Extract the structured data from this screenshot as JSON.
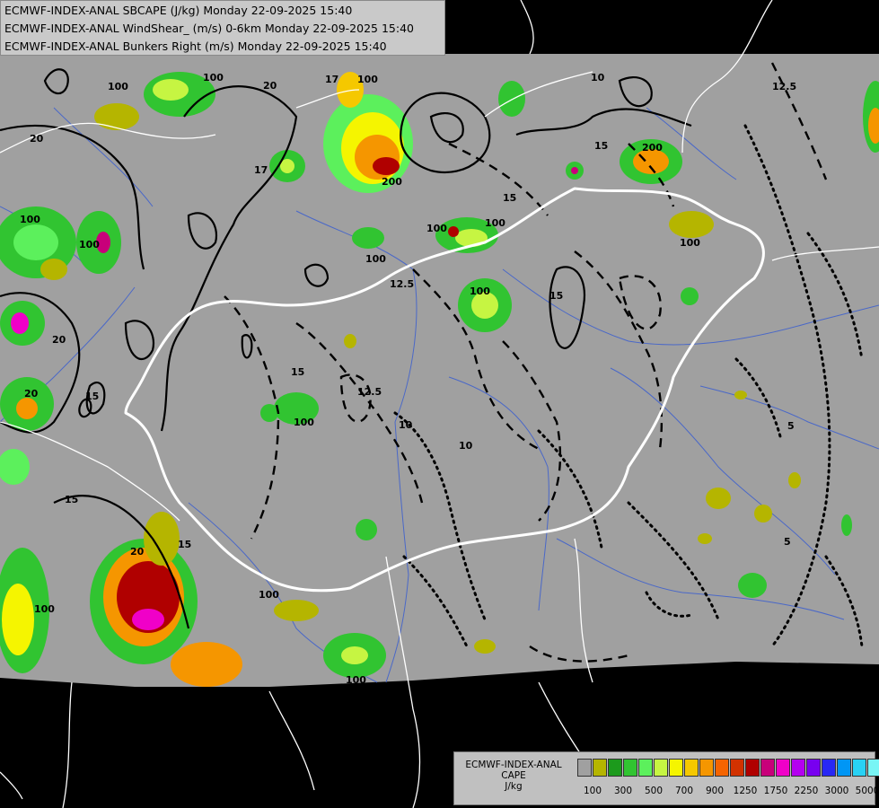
{
  "titles": [
    "ECMWF-INDEX-ANAL SBCAPE (J/kg) Monday 22-09-2025 15:40",
    "ECMWF-INDEX-ANAL WindShear_ (m/s) 0-6km Monday 22-09-2025 15:40",
    "ECMWF-INDEX-ANAL Bunkers Right (m/s) Monday 22-09-2025 15:40"
  ],
  "legend": {
    "name_lines": [
      "ECMWF-INDEX-ANAL",
      "CAPE",
      "J/kg"
    ],
    "colors": [
      "#a0a0a0",
      "#b5b500",
      "#1c9a1c",
      "#31c431",
      "#5cf05c",
      "#c6f542",
      "#f5f500",
      "#f5c800",
      "#f59600",
      "#f56400",
      "#d23200",
      "#b00000",
      "#c8007a",
      "#f000c8",
      "#b400f0",
      "#7800f0",
      "#2828f5",
      "#0096f5",
      "#28d2f5",
      "#78f5f5",
      "#ffffff"
    ],
    "tick_labels": [
      "100",
      "300",
      "500",
      "700",
      "900",
      "1250",
      "1750",
      "2250",
      "3000",
      "5000"
    ]
  },
  "contour_labels": {
    "cape": [
      "100",
      "100",
      "100",
      "100",
      "100",
      "100",
      "100",
      "100",
      "100",
      "100",
      "100",
      "100",
      "100",
      "100",
      "200",
      "200"
    ],
    "wind_shear": [
      "20",
      "20",
      "20",
      "20",
      "20",
      "17",
      "17",
      "15",
      "15",
      "15",
      "15",
      "15",
      "15",
      "12.5",
      "10",
      "10",
      "10",
      "5",
      "5"
    ],
    "bunkers": [
      "15",
      "12.5",
      "12.5",
      "10"
    ]
  },
  "colors": {
    "background": "#000000",
    "domain": "#a0a0a0",
    "country_border": "#ffffff",
    "rivers": "#4a68c8",
    "contours": "#000000"
  }
}
